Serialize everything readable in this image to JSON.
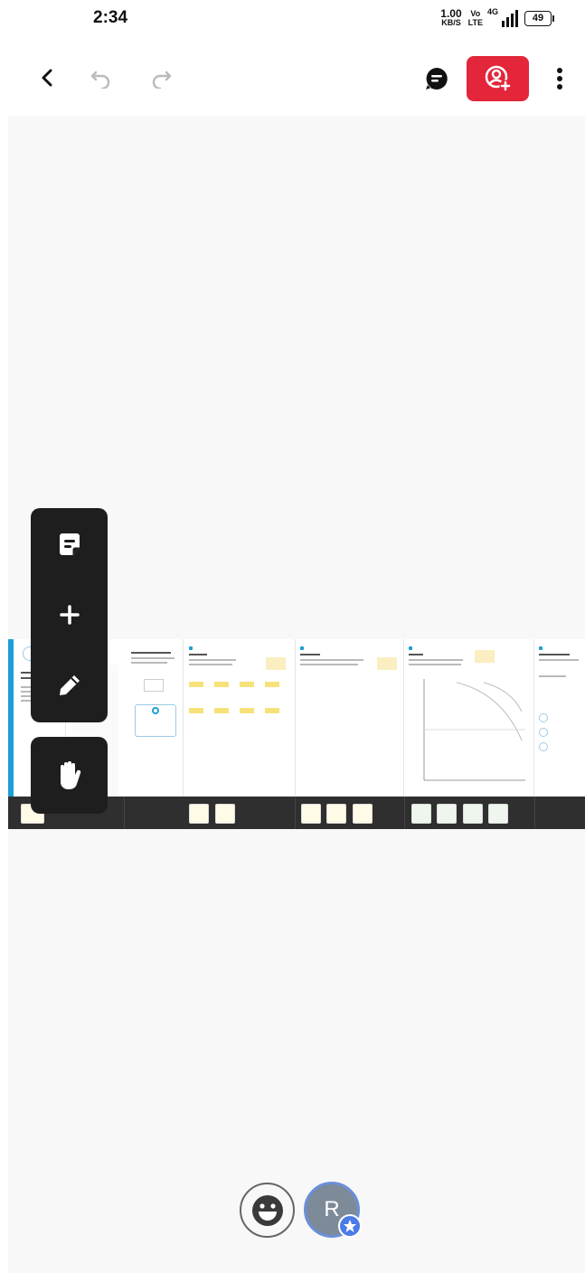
{
  "status_bar": {
    "time": "2:34",
    "net_speed_value": "1.00",
    "net_speed_unit": "KB/S",
    "volte_top": "Vo",
    "volte_bottom": "LTE",
    "network": "4G",
    "battery": "49"
  },
  "toolbar": {
    "back_icon": "chevron-left-icon",
    "undo_icon": "undo-icon",
    "redo_icon": "redo-icon",
    "chat_icon": "chat-bubble-icon",
    "share_icon": "add-user-icon",
    "share_color": "#e3263a",
    "more_icon": "more-vertical-icon"
  },
  "tools": {
    "sticky_note_icon": "sticky-note-icon",
    "add_icon": "plus-icon",
    "pen_icon": "pen-icon",
    "hand_icon": "hand-icon"
  },
  "bottom": {
    "reaction_icon": "smiley-icon",
    "avatar_initial": "R",
    "avatar_badge_icon": "star-icon",
    "avatar_color": "#7d8b99",
    "accent_color": "#4c7be8"
  }
}
